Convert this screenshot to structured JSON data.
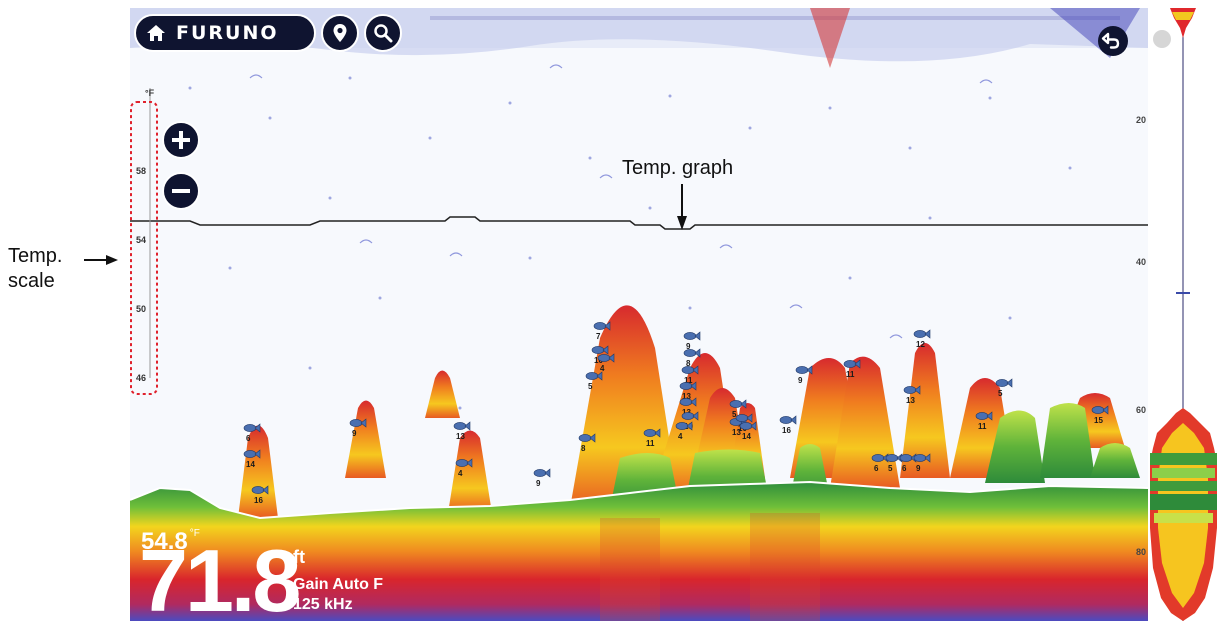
{
  "annotations": {
    "temp_scale": [
      "Temp.",
      "scale"
    ],
    "temp_graph": "Temp. graph"
  },
  "toolbar": {
    "brand": "FURUNO",
    "home_icon": "home-icon",
    "waypoint_icon": "map-pin-icon",
    "search_icon": "search-icon",
    "back_icon": "undo-arrow-icon"
  },
  "zoom": {
    "in_icon": "plus-icon",
    "out_icon": "minus-icon"
  },
  "temp_scale": {
    "unit": "°F",
    "ticks": [
      "58",
      "54",
      "50",
      "46"
    ]
  },
  "depth_scale": {
    "ticks": [
      "20",
      "40",
      "60",
      "80"
    ]
  },
  "readout": {
    "water_temp": "54.8",
    "water_temp_unit": "°F",
    "depth": "71.8",
    "depth_unit": "ft",
    "gain": "Gain Auto F",
    "frequency": "125 kHz"
  },
  "fish_symbols": [
    "9",
    "6",
    "14",
    "16",
    "13",
    "4",
    "9",
    "7",
    "10",
    "4",
    "5",
    "8",
    "11",
    "9",
    "8",
    "11",
    "13",
    "13",
    "10",
    "4",
    "5",
    "13",
    "10",
    "14",
    "16",
    "9",
    "11",
    "12",
    "13",
    "5",
    "11",
    "15",
    "6",
    "5",
    "6",
    "9"
  ],
  "colors": {
    "background": "#f7f9fd",
    "bottom_green": "#2e8b3a",
    "echo_red": "#d8252b",
    "echo_yellow": "#f4d21f",
    "noise_blue": "#4b56c8",
    "panel_button": "#0f1430"
  }
}
